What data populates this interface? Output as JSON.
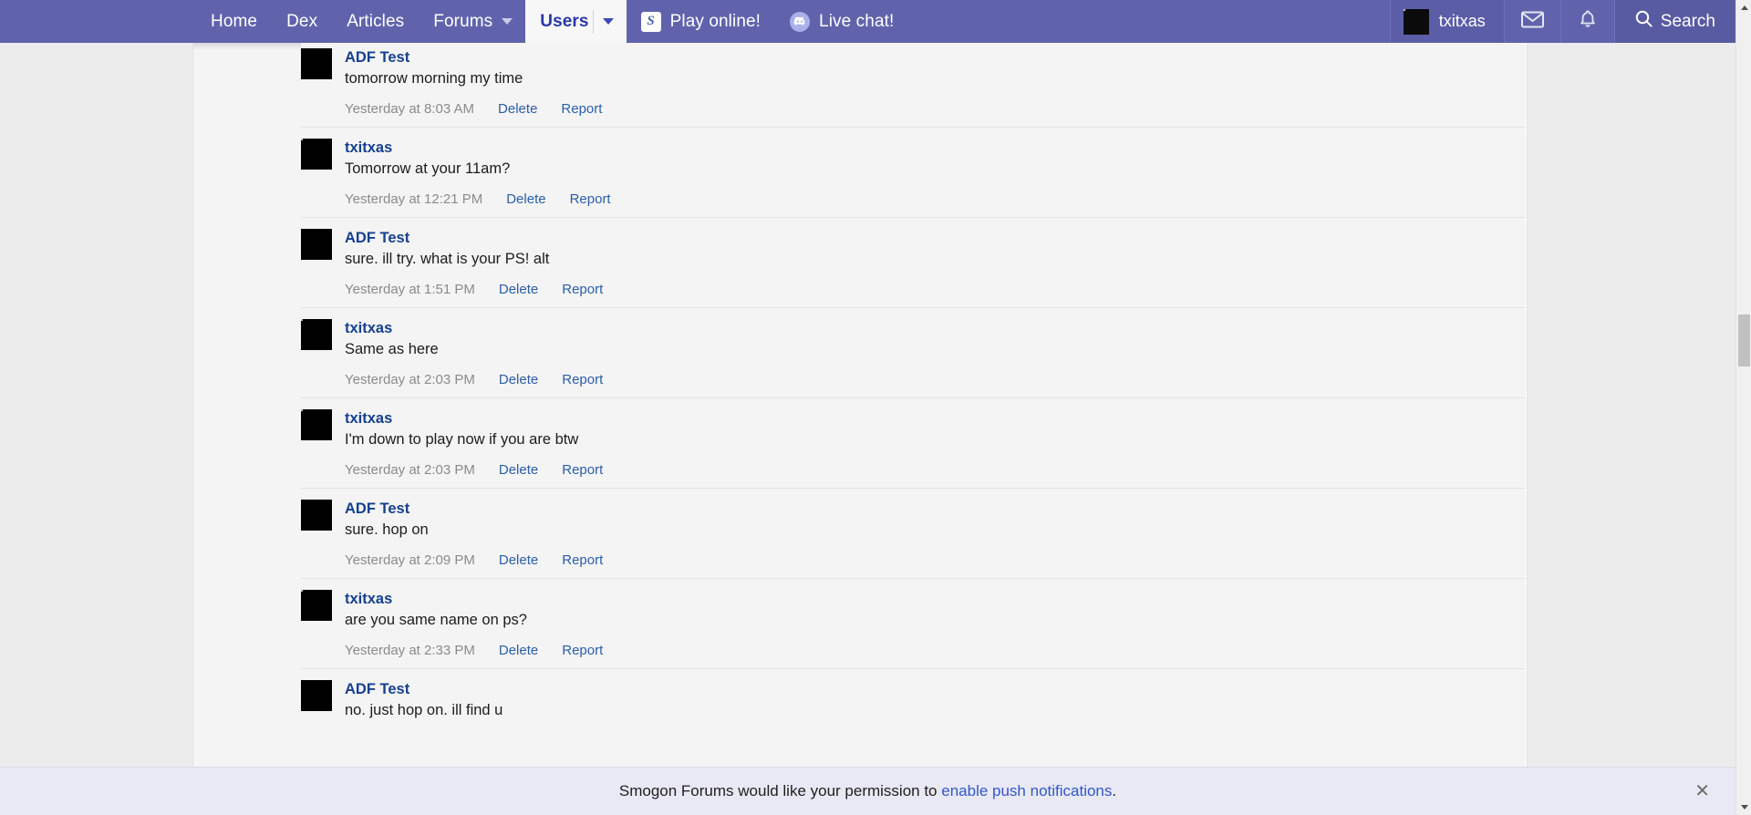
{
  "nav": {
    "primary": [
      {
        "label": "Home",
        "caret": false,
        "active": false
      },
      {
        "label": "Dex",
        "caret": false,
        "active": false
      },
      {
        "label": "Articles",
        "caret": false,
        "active": false
      },
      {
        "label": "Forums",
        "caret": true,
        "active": false
      },
      {
        "label": "Users",
        "caret": true,
        "active": true
      }
    ],
    "play_online": {
      "label": "Play online!",
      "icon": "smogon-ps-icon",
      "icon_glyph": "S"
    },
    "live_chat": {
      "label": "Live chat!",
      "icon": "discord-icon",
      "icon_glyph": "●●"
    },
    "user": {
      "name": "txitxas",
      "avatar": "stick-figure-avatar"
    },
    "inbox": {
      "icon": "envelope-icon",
      "glyph": "✉"
    },
    "alerts": {
      "icon": "bell-icon",
      "glyph": "☑"
    },
    "search": {
      "label": "Search",
      "icon": "search-icon",
      "glyph": "⌕"
    }
  },
  "colors": {
    "navbar": "#6063ac",
    "nav_active_bg": "#f7f7f8",
    "nav_active_text": "#2b38a8",
    "link": "#2b5ea8",
    "username": "#16408f",
    "content_bg": "#f4f4f4",
    "page_bg": "#ececec",
    "notif_bg": "#e9e9f5",
    "notif_link": "#3257c8",
    "muted_text": "#8b8b8b"
  },
  "conversation": {
    "messages": [
      {
        "user": "ADF Test",
        "avatar": "photo-avatar",
        "text": "tomorrow morning my time",
        "date": "Yesterday at 8:03 AM",
        "actions": [
          "Delete",
          "Report"
        ]
      },
      {
        "user": "txitxas",
        "avatar": "stick-figure-avatar",
        "text": "Tomorrow at your 11am?",
        "date": "Yesterday at 12:21 PM",
        "actions": [
          "Delete",
          "Report"
        ]
      },
      {
        "user": "ADF Test",
        "avatar": "photo-avatar",
        "text": "sure. ill try. what is your PS! alt",
        "date": "Yesterday at 1:51 PM",
        "actions": [
          "Delete",
          "Report"
        ]
      },
      {
        "user": "txitxas",
        "avatar": "stick-figure-avatar",
        "text": "Same as here",
        "date": "Yesterday at 2:03 PM",
        "actions": [
          "Delete",
          "Report"
        ]
      },
      {
        "user": "txitxas",
        "avatar": "stick-figure-avatar",
        "text": "I'm down to play now if you are btw",
        "date": "Yesterday at 2:03 PM",
        "actions": [
          "Delete",
          "Report"
        ]
      },
      {
        "user": "ADF Test",
        "avatar": "photo-avatar",
        "text": "sure. hop on",
        "date": "Yesterday at 2:09 PM",
        "actions": [
          "Delete",
          "Report"
        ]
      },
      {
        "user": "txitxas",
        "avatar": "stick-figure-avatar",
        "text": "are you same name on ps?",
        "date": "Yesterday at 2:33 PM",
        "actions": [
          "Delete",
          "Report"
        ]
      },
      {
        "user": "ADF Test",
        "avatar": "photo-avatar",
        "text": "no. just hop on. ill find u",
        "date": "",
        "actions": []
      }
    ]
  },
  "notification_bar": {
    "text_before": "Smogon Forums would like your permission to ",
    "link": "enable push notifications",
    "text_after": ".",
    "close_glyph": "✕"
  },
  "scrollbar": {
    "up_glyph": "▲",
    "down_glyph": "▼"
  }
}
